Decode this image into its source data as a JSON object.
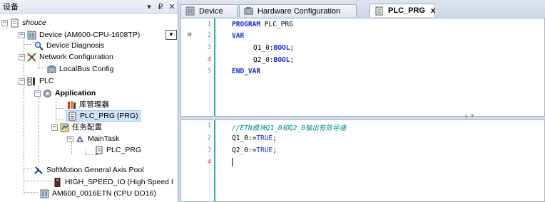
{
  "left_panel": {
    "title": "设备",
    "pin_glyph": "▾ ₽",
    "close_glyph": "✕",
    "tree": {
      "root": "shouce",
      "device": "Device (AM600-CPU-1608TP)",
      "device_diagnosis": "Device Diagnosis",
      "network_configuration": "Network Configuration",
      "localbus_config": "LocalBus Config",
      "plc": "PLC",
      "application": "Application",
      "library_manager": "库管理器",
      "plc_prg": "PLC_PRG (PRG)",
      "task_config": "任务配置",
      "main_task": "MainTask",
      "main_task_prg": "PLC_PRG",
      "softmotion": "SoftMotion General Axis Pool",
      "high_speed_io": "HIGH_SPEED_IO (High Speed I",
      "am600_etn": "AM600_0016ETN (CPU DO16)"
    }
  },
  "tabs": [
    {
      "label": "Device",
      "icon": "device-icon"
    },
    {
      "label": "Hardware Configuration",
      "icon": "hardware-icon"
    },
    {
      "label": "PLC_PRG",
      "icon": "document-icon",
      "active": true
    }
  ],
  "tab_close": "x",
  "editor_top": {
    "lines": [
      {
        "n": "1",
        "kw": "PROGRAM",
        "rest": " PLC_PRG"
      },
      {
        "n": "2",
        "kw": "VAR",
        "rest": ""
      },
      {
        "n": "3",
        "name": "Q1_0:",
        "type": "BOOL",
        "end": ";"
      },
      {
        "n": "4",
        "name": "Q2_0:",
        "type": "BOOL",
        "end": ";"
      },
      {
        "n": "5",
        "kw": "END_VAR",
        "rest": ""
      }
    ],
    "fold_glyph": "⊟"
  },
  "editor_bottom": {
    "lines": [
      {
        "n": "1",
        "comment": "//ETN模块Q1_0和Q2_0输出有效导通"
      },
      {
        "n": "2",
        "name": "Q1_0:=",
        "value": "TRUE",
        "end": ";"
      },
      {
        "n": "3",
        "name": "Q2_0:=",
        "value": "TRUE",
        "end": ";"
      },
      {
        "n": "4"
      }
    ]
  },
  "colors": {
    "keyword": "#1a2bd2",
    "comment": "#0b8a8a",
    "line_marker": "#c8322e",
    "gutter_bar": "#3ca7a7"
  }
}
